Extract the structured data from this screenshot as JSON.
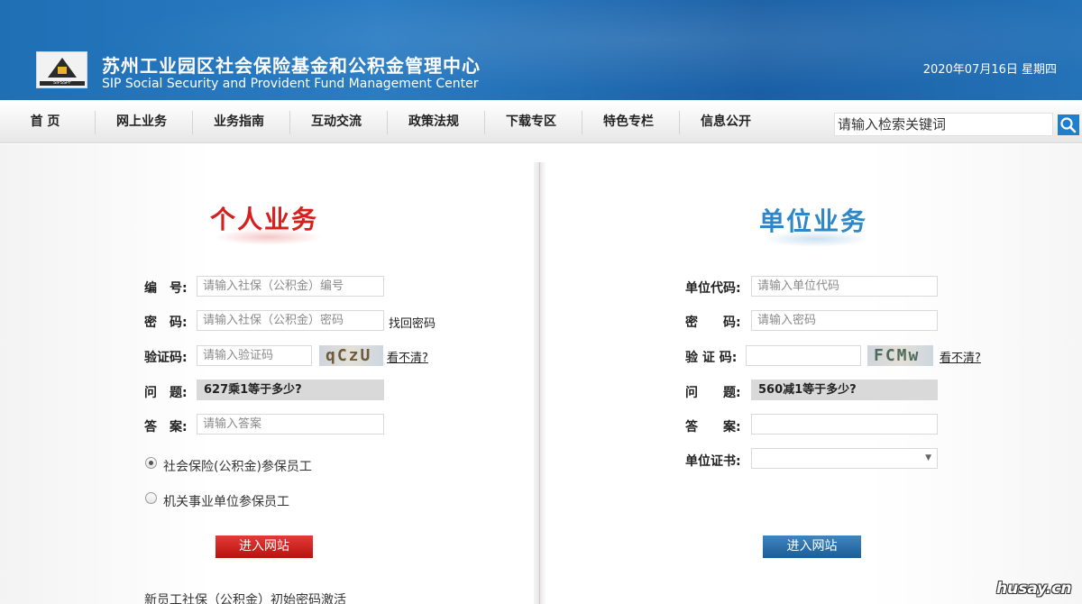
{
  "header": {
    "title_cn": "苏州工业园区社会保险基金和公积金管理中心",
    "title_en": "SIP Social Security and Provident Fund Management Center",
    "logo_text": "SIPSSPF",
    "date": "2020年07月16日 星期四"
  },
  "nav": {
    "items": [
      "首 页",
      "网上业务",
      "业务指南",
      "互动交流",
      "政策法规",
      "下载专区",
      "特色专栏",
      "信息公开"
    ],
    "search_placeholder": "请输入检索关键词"
  },
  "personal": {
    "title": "个人业务",
    "id_label": "编　号:",
    "id_placeholder": "请输入社保（公积金）编号",
    "pwd_label": "密　码:",
    "pwd_placeholder": "请输入社保（公积金）密码",
    "forgot_link": "找回密码",
    "captcha_label": "验证码:",
    "captcha_placeholder": "请输入验证码",
    "captcha_text": "qCzU",
    "refresh_link": "看不清?",
    "question_label": "问　题:",
    "question_text": "627乘1等于多少?",
    "answer_label": "答　案:",
    "answer_placeholder": "请输入答案",
    "radio_1": "社会保险(公积金)参保员工",
    "radio_2": "机关事业单位参保员工",
    "submit": "进入网站",
    "bottom_link": "新员工社保（公积金）初始密码激活"
  },
  "company": {
    "title": "单位业务",
    "code_label": "单位代码:",
    "code_placeholder": "请输入单位代码",
    "pwd_label": "密　　码:",
    "pwd_placeholder": "请输入密码",
    "captcha_label": "验 证 码:",
    "captcha_text": "FCMw",
    "refresh_link": "看不清?",
    "question_label": "问　　题:",
    "question_text": "560减1等于多少?",
    "answer_label": "答　　案:",
    "cert_label": "单位证书:",
    "submit": "进入网站"
  },
  "watermark": "husay.cn",
  "colors": {
    "header_blue": "#1f6fb5",
    "personal_red": "#d6201e",
    "company_blue": "#2f86c8"
  }
}
